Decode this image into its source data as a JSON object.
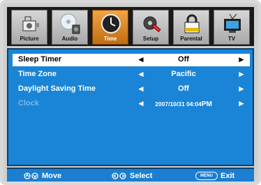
{
  "tabs": [
    {
      "id": "picture",
      "label": "Picture",
      "icon": "camera-icon"
    },
    {
      "id": "audio",
      "label": "Audio",
      "icon": "cd-speaker-icon"
    },
    {
      "id": "time",
      "label": "Time",
      "icon": "clock-icon",
      "active": true
    },
    {
      "id": "setup",
      "label": "Setup",
      "icon": "gear-wrench-icon"
    },
    {
      "id": "parental",
      "label": "Parental",
      "icon": "lock-icon"
    },
    {
      "id": "tv",
      "label": "TV",
      "icon": "tv-antenna-icon"
    }
  ],
  "menu": {
    "rows": [
      {
        "label": "Sleep Timer",
        "value": "Off",
        "selected": true
      },
      {
        "label": "Time Zone",
        "value": "Pacific"
      },
      {
        "label": "Daylight Saving Time",
        "value": "Off"
      },
      {
        "label": "Clock",
        "value": "2007/10/31 04:04",
        "value_suffix": "PM",
        "disabled": true
      }
    ],
    "arrow_left": "◄",
    "arrow_right": "►"
  },
  "footer": {
    "move_label": "Move",
    "select_label": "Select",
    "menu_key": "MENU",
    "exit_label": "Exit"
  },
  "colors": {
    "accent": "#1a85d6",
    "active_tab": "#e08a22"
  }
}
